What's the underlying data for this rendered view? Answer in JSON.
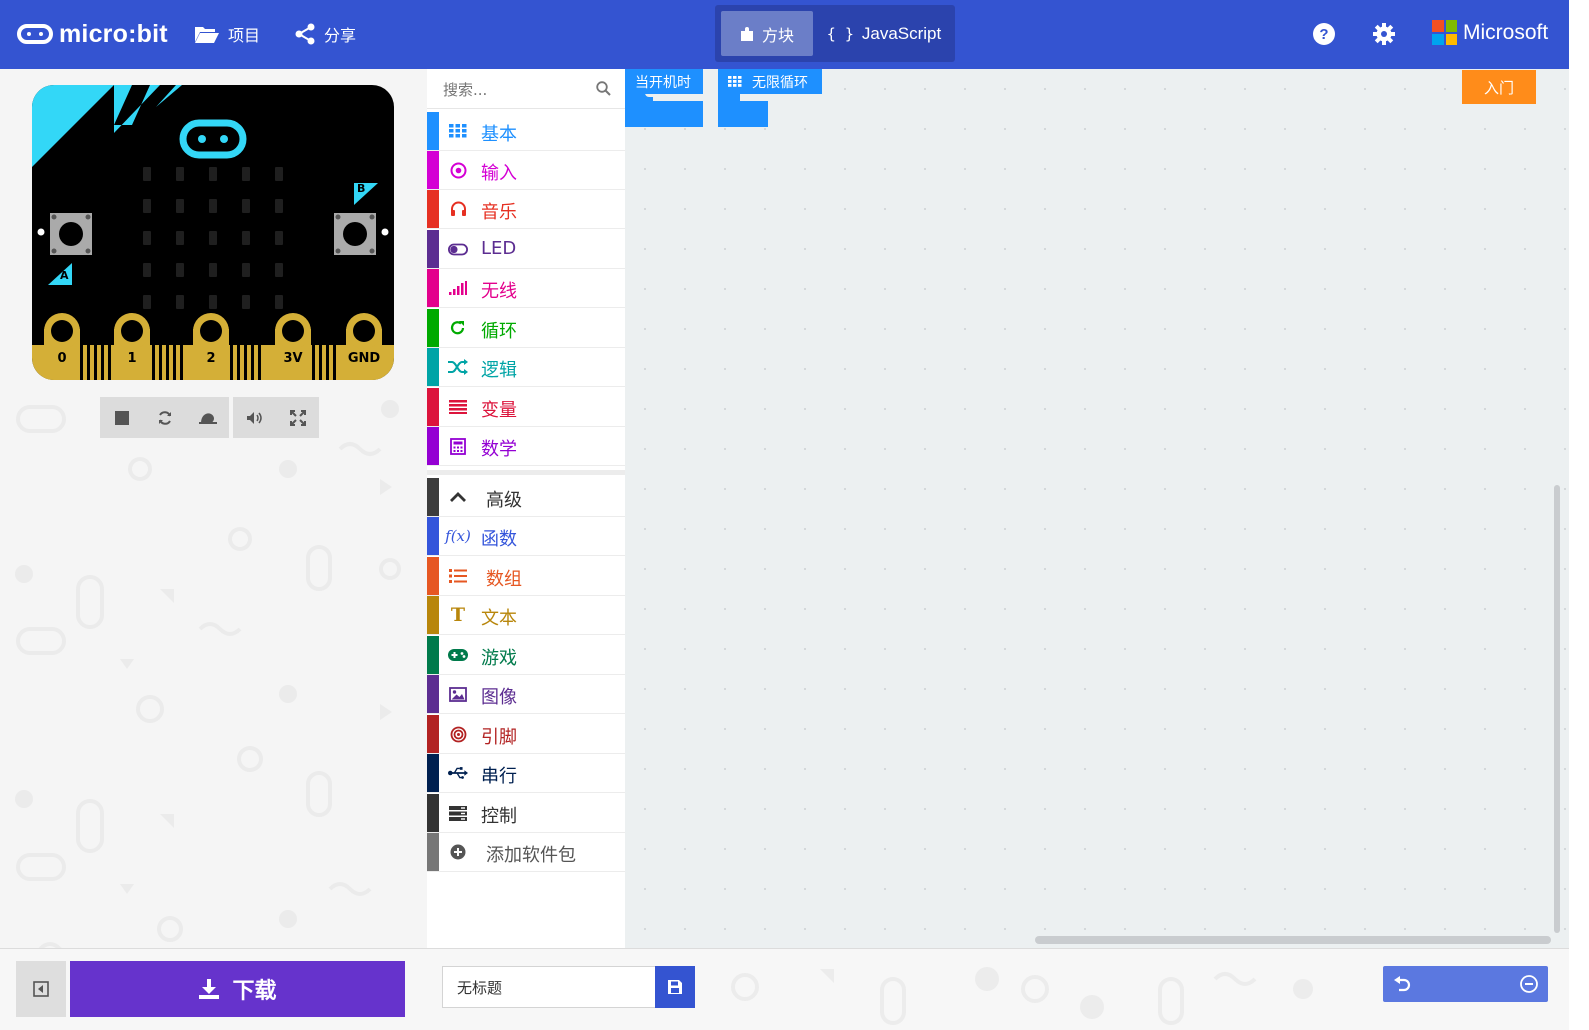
{
  "header": {
    "logo_text": "micro:bit",
    "projects_label": "项目",
    "share_label": "分享",
    "mode_blocks_label": "方块",
    "mode_js_label": "JavaScript",
    "microsoft_label": "Microsoft",
    "accent_color": "#3454d1"
  },
  "simulator": {
    "pins": [
      "0",
      "1",
      "2",
      "3V",
      "GND"
    ],
    "button_a": "A",
    "button_b": "B"
  },
  "toolbox": {
    "search_placeholder": "搜索...",
    "categories": [
      {
        "label": "基本",
        "color": "#1e90ff",
        "icon": "grid-icon"
      },
      {
        "label": "输入",
        "color": "#d400d4",
        "icon": "target-icon"
      },
      {
        "label": "音乐",
        "color": "#e63022",
        "icon": "headphones-icon"
      },
      {
        "label": "LED",
        "color": "#5c2d91",
        "icon": "toggle-icon"
      },
      {
        "label": "无线",
        "color": "#e3008c",
        "icon": "signal-icon"
      },
      {
        "label": "循环",
        "color": "#00aa00",
        "icon": "refresh-icon"
      },
      {
        "label": "逻辑",
        "color": "#00a4a6",
        "icon": "shuffle-icon"
      },
      {
        "label": "变量",
        "color": "#dc143c",
        "icon": "list-icon"
      },
      {
        "label": "数学",
        "color": "#9400d3",
        "icon": "calculator-icon"
      }
    ],
    "advanced_label": "高级",
    "advanced": [
      {
        "label": "函数",
        "color": "#3455db",
        "icon": "function-icon"
      },
      {
        "label": "数组",
        "color": "#e65722",
        "icon": "ordered-list-icon"
      },
      {
        "label": "文本",
        "color": "#b8860b",
        "icon": "text-icon"
      },
      {
        "label": "游戏",
        "color": "#007a4b",
        "icon": "gamepad-icon"
      },
      {
        "label": "图像",
        "color": "#5c2d91",
        "icon": "image-icon"
      },
      {
        "label": "引脚",
        "color": "#b22222",
        "icon": "pin-icon"
      },
      {
        "label": "串行",
        "color": "#002050",
        "icon": "usb-icon"
      },
      {
        "label": "控制",
        "color": "#333333",
        "icon": "server-icon"
      }
    ],
    "add_package_label": "添加软件包"
  },
  "workspace": {
    "on_start_label": "当开机时",
    "forever_label": "无限循环",
    "block_color": "#1e90ff",
    "get_started_label": "入门"
  },
  "footer": {
    "download_label": "下载",
    "project_name": "无标题",
    "download_color": "#6633cc"
  }
}
